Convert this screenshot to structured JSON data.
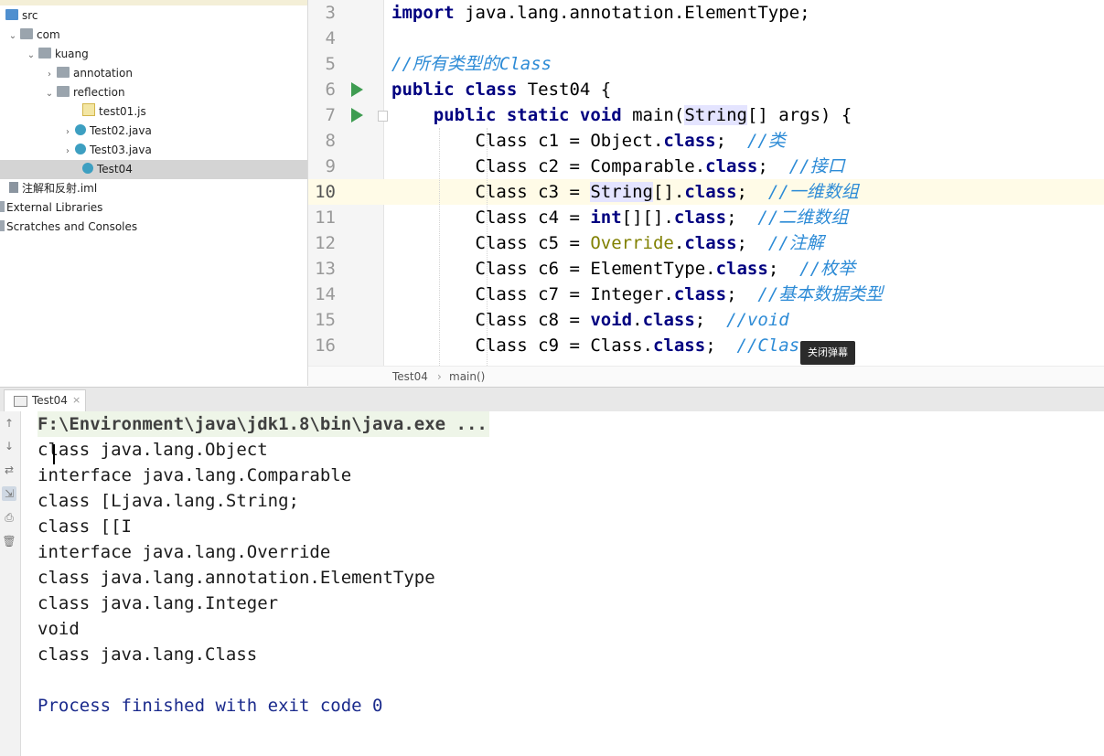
{
  "project_tree": {
    "items": [
      {
        "label": "src",
        "icon": "source-folder-icon"
      },
      {
        "label": "com",
        "icon": "package-folder-icon"
      },
      {
        "label": "kuang",
        "icon": "package-folder-icon"
      },
      {
        "label": "annotation",
        "icon": "package-folder-icon"
      },
      {
        "label": "reflection",
        "icon": "package-folder-icon"
      },
      {
        "label": "test01.js",
        "icon": "js-file-icon"
      },
      {
        "label": "Test02.java",
        "icon": "java-class-icon"
      },
      {
        "label": "Test03.java",
        "icon": "java-class-icon"
      },
      {
        "label": "Test04",
        "icon": "java-class-icon"
      },
      {
        "label": "注解和反射.iml",
        "icon": "iml-file-icon"
      },
      {
        "label": "External Libraries",
        "icon": "libraries-icon"
      },
      {
        "label": "Scratches and Consoles",
        "icon": "scratches-icon"
      }
    ]
  },
  "editor": {
    "lines": [
      {
        "num": "3",
        "segs": [
          {
            "t": "import",
            "c": "kw"
          },
          {
            "t": " java.lang.annotation.ElementType;",
            "c": ""
          }
        ]
      },
      {
        "num": "4",
        "segs": []
      },
      {
        "num": "5",
        "segs": [
          {
            "t": "//所有类型的Class",
            "c": "cm"
          }
        ]
      },
      {
        "num": "6",
        "segs": [
          {
            "t": "public class",
            "c": "kw"
          },
          {
            "t": " Test04 {",
            "c": ""
          }
        ]
      },
      {
        "num": "7",
        "segs": [
          {
            "t": "    ",
            "c": ""
          },
          {
            "t": "public static void",
            "c": "kw"
          },
          {
            "t": " main(",
            "c": ""
          },
          {
            "t": "String",
            "c": "hl"
          },
          {
            "t": "[] args) {",
            "c": ""
          }
        ]
      },
      {
        "num": "8",
        "segs": [
          {
            "t": "        Class c1 = Object.",
            "c": ""
          },
          {
            "t": "class",
            "c": "kw"
          },
          {
            "t": ";  ",
            "c": ""
          },
          {
            "t": "//类",
            "c": "cm"
          }
        ]
      },
      {
        "num": "9",
        "segs": [
          {
            "t": "        Class c2 = Comparable.",
            "c": ""
          },
          {
            "t": "class",
            "c": "kw"
          },
          {
            "t": ";  ",
            "c": ""
          },
          {
            "t": "//接口",
            "c": "cm"
          }
        ]
      },
      {
        "num": "10",
        "segs": [
          {
            "t": "        Class c3 = ",
            "c": ""
          },
          {
            "t": "String",
            "c": "hl"
          },
          {
            "t": "[].",
            "c": ""
          },
          {
            "t": "class",
            "c": "kw"
          },
          {
            "t": ";  ",
            "c": ""
          },
          {
            "t": "//一维数组",
            "c": "cm"
          }
        ]
      },
      {
        "num": "11",
        "segs": [
          {
            "t": "        Class c4 = ",
            "c": ""
          },
          {
            "t": "int",
            "c": "kw"
          },
          {
            "t": "[][].",
            "c": ""
          },
          {
            "t": "class",
            "c": "kw"
          },
          {
            "t": ";  ",
            "c": ""
          },
          {
            "t": "//二维数组",
            "c": "cm"
          }
        ]
      },
      {
        "num": "12",
        "segs": [
          {
            "t": "        Class c5 = ",
            "c": ""
          },
          {
            "t": "Override",
            "c": "ann"
          },
          {
            "t": ".",
            "c": ""
          },
          {
            "t": "class",
            "c": "kw"
          },
          {
            "t": ";  ",
            "c": ""
          },
          {
            "t": "//注解",
            "c": "cm"
          }
        ]
      },
      {
        "num": "13",
        "segs": [
          {
            "t": "        Class c6 = ElementType.",
            "c": ""
          },
          {
            "t": "class",
            "c": "kw"
          },
          {
            "t": ";  ",
            "c": ""
          },
          {
            "t": "//枚举",
            "c": "cm"
          }
        ]
      },
      {
        "num": "14",
        "segs": [
          {
            "t": "        Class c7 = Integer.",
            "c": ""
          },
          {
            "t": "class",
            "c": "kw"
          },
          {
            "t": ";  ",
            "c": ""
          },
          {
            "t": "//基本数据类型",
            "c": "cm"
          }
        ]
      },
      {
        "num": "15",
        "segs": [
          {
            "t": "        Class c8 = ",
            "c": ""
          },
          {
            "t": "void",
            "c": "kw"
          },
          {
            "t": ".",
            "c": ""
          },
          {
            "t": "class",
            "c": "kw"
          },
          {
            "t": ";  ",
            "c": ""
          },
          {
            "t": "//void",
            "c": "cm"
          }
        ]
      },
      {
        "num": "16",
        "segs": [
          {
            "t": "        Class c9 = Class.",
            "c": ""
          },
          {
            "t": "class",
            "c": "kw"
          },
          {
            "t": ";  ",
            "c": ""
          },
          {
            "t": "//Class",
            "c": "cm"
          }
        ]
      }
    ]
  },
  "breadcrumb": {
    "file": "Test04",
    "separator": "›",
    "method": "main()"
  },
  "tooltip": {
    "text": "关闭弹幕"
  },
  "run_panel": {
    "tab_label": "Test04",
    "tab_close": "×",
    "command": "F:\\Environment\\java\\jdk1.8\\bin\\java.exe ...",
    "output": [
      "class java.lang.Object",
      "interface java.lang.Comparable",
      "class [Ljava.lang.String;",
      "class [[I",
      "interface java.lang.Override",
      "class java.lang.annotation.ElementType",
      "class java.lang.Integer",
      "void",
      "class java.lang.Class"
    ],
    "exit_message": "Process finished with exit code 0"
  },
  "colors": {
    "keyword": "#000080",
    "comment": "#2d8bd6",
    "annotation": "#808000",
    "run_icon": "#3e9c51",
    "current_line": "#fffbe7"
  }
}
